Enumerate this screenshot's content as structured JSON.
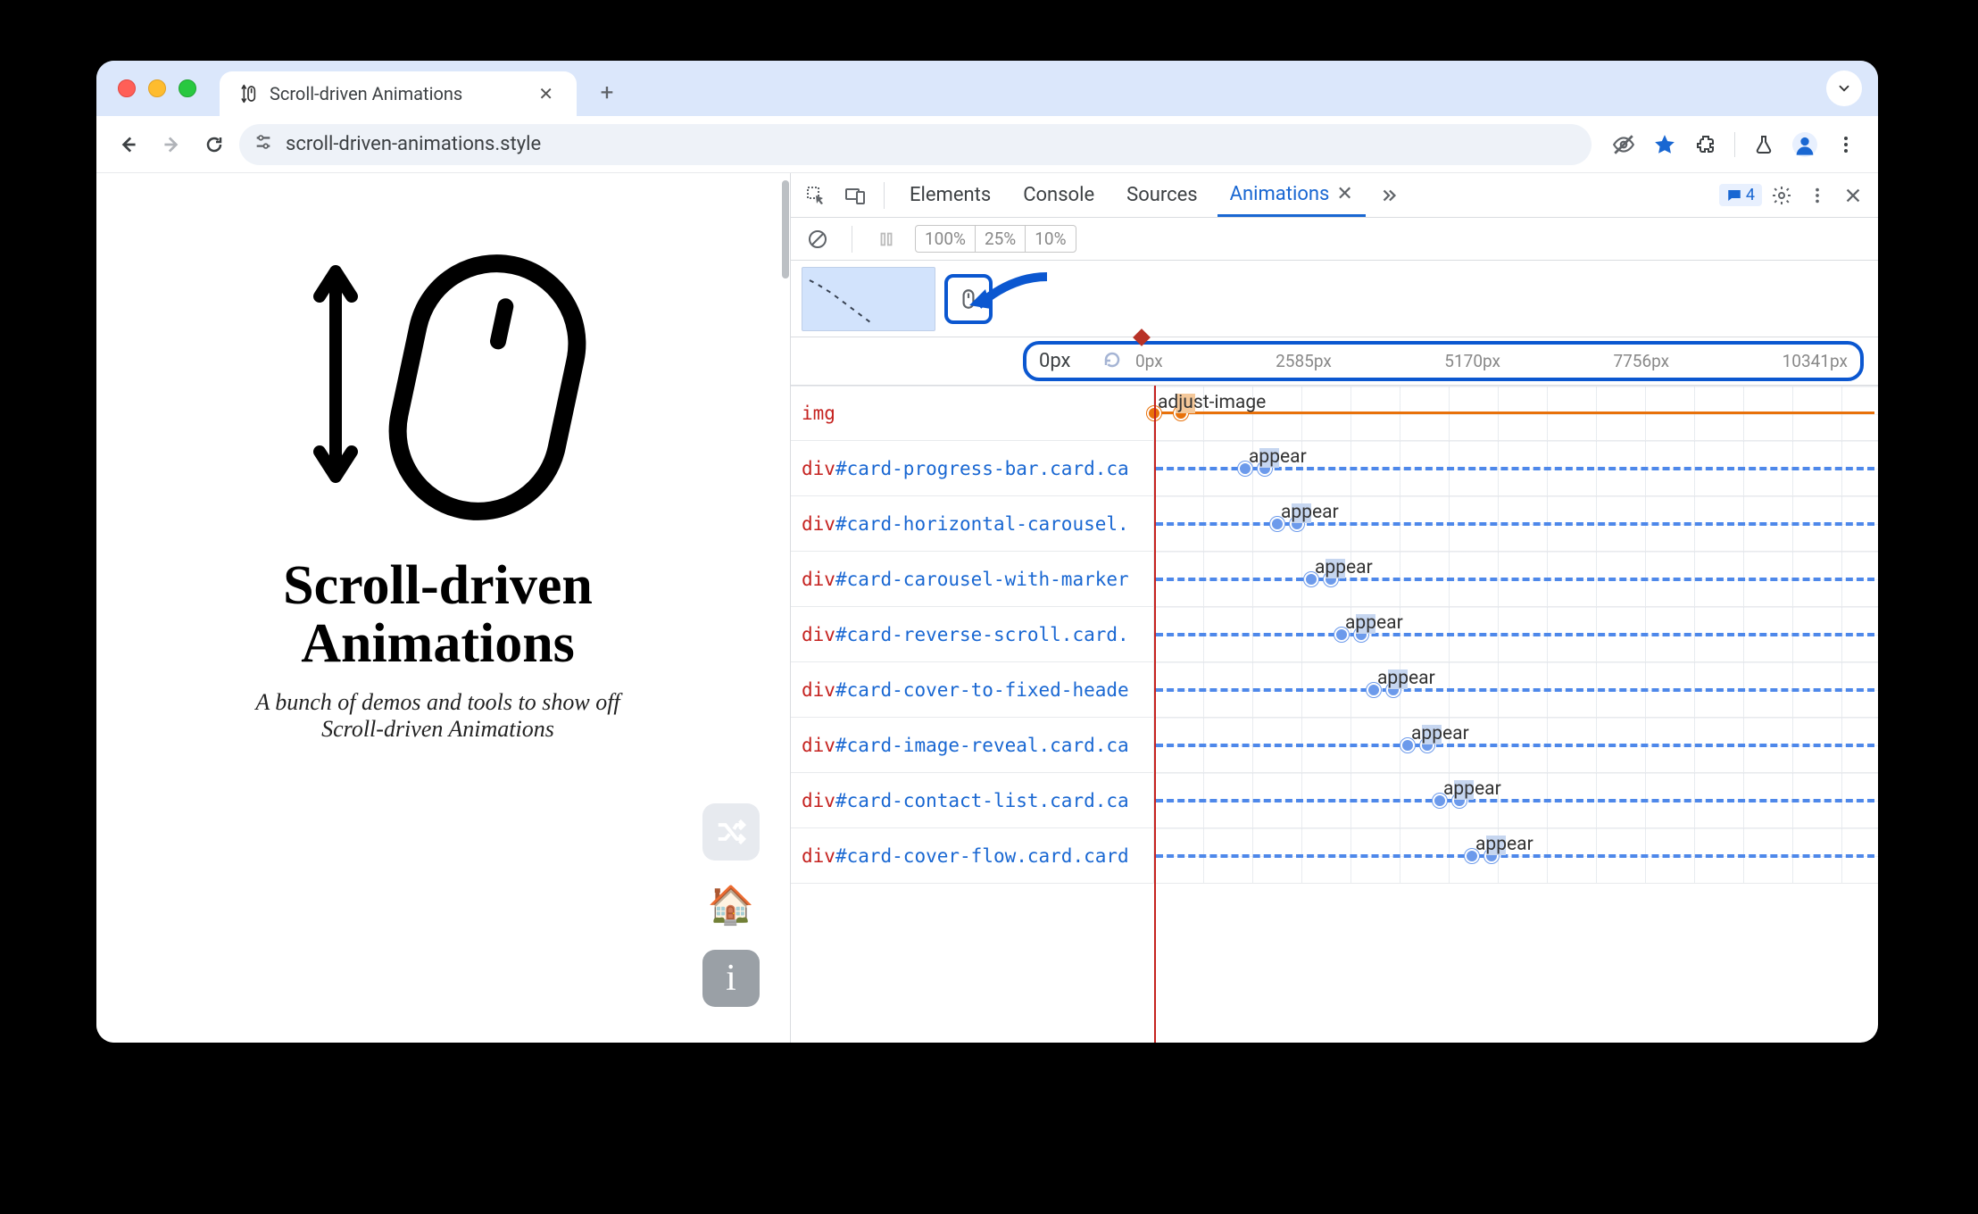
{
  "browser": {
    "tab_title": "Scroll-driven Animations",
    "url": "scroll-driven-animations.style"
  },
  "page": {
    "title_line1": "Scroll-driven",
    "title_line2": "Animations",
    "subtitle_line1": "A bunch of demos and tools to show off",
    "subtitle_line2": "Scroll-driven Animations"
  },
  "devtools": {
    "tabs": {
      "elements": "Elements",
      "console": "Console",
      "sources": "Sources",
      "animations": "Animations"
    },
    "message_count": "4",
    "speeds": {
      "s100": "100%",
      "s25": "25%",
      "s10": "10%"
    },
    "ruler": {
      "current": "0px",
      "ticks": [
        "0px",
        "2585px",
        "5170px",
        "7756px",
        "10341px"
      ]
    },
    "rows": [
      {
        "tag": "img",
        "sel": "",
        "anim": "adjust-image",
        "start": 0,
        "seg": 30,
        "type": "orange"
      },
      {
        "tag": "div",
        "sel": "#card-progress-bar.card.ca",
        "anim": "appear",
        "start": 102,
        "seg": 22
      },
      {
        "tag": "div",
        "sel": "#card-horizontal-carousel.",
        "anim": "appear",
        "start": 138,
        "seg": 22
      },
      {
        "tag": "div",
        "sel": "#card-carousel-with-marker",
        "anim": "appear",
        "start": 176,
        "seg": 22
      },
      {
        "tag": "div",
        "sel": "#card-reverse-scroll.card.",
        "anim": "appear",
        "start": 210,
        "seg": 22
      },
      {
        "tag": "div",
        "sel": "#card-cover-to-fixed-heade",
        "anim": "appear",
        "start": 246,
        "seg": 22
      },
      {
        "tag": "div",
        "sel": "#card-image-reveal.card.ca",
        "anim": "appear",
        "start": 284,
        "seg": 22
      },
      {
        "tag": "div",
        "sel": "#card-contact-list.card.ca",
        "anim": "appear",
        "start": 320,
        "seg": 22
      },
      {
        "tag": "div",
        "sel": "#card-cover-flow.card.card",
        "anim": "appear",
        "start": 356,
        "seg": 22
      }
    ]
  }
}
